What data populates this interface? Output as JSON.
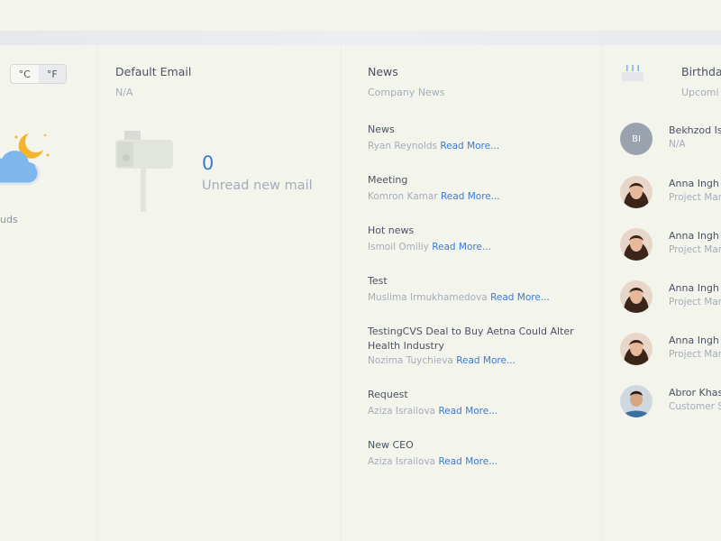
{
  "weather": {
    "unit_c": "°C",
    "unit_f": "°F",
    "description": "uds"
  },
  "email": {
    "title": "Default Email",
    "subtitle": "N/A",
    "unread_count": "0",
    "unread_label": "Unread new mail"
  },
  "news": {
    "title": "News",
    "subtitle": "Company News",
    "read_more": "Read More...",
    "items": [
      {
        "title": "News",
        "author": "Ryan Reynolds"
      },
      {
        "title": "Meeting",
        "author": "Komron Kamar"
      },
      {
        "title": "Hot news",
        "author": "Ismoil Omiliy"
      },
      {
        "title": "Test",
        "author": "Muslima Irmukhamedova"
      },
      {
        "title": "TestingCVS Deal to Buy Aetna Could Alter Health Industry",
        "author": "Nozima Tuychieva"
      },
      {
        "title": "Request",
        "author": "Aziza Israilova"
      },
      {
        "title": "New CEO",
        "author": "Aziza Israilova"
      }
    ]
  },
  "birthdays": {
    "title": "Birthda",
    "subtitle": "Upcomi",
    "people": [
      {
        "initials": "BI",
        "name": "Bekhzod Is",
        "role": "N/A",
        "avatar": "initials"
      },
      {
        "initials": "",
        "name": "Anna Ingh",
        "role": "Project Man",
        "avatar": "female"
      },
      {
        "initials": "",
        "name": "Anna Ingh",
        "role": "Project Man",
        "avatar": "female"
      },
      {
        "initials": "",
        "name": "Anna Ingh",
        "role": "Project Man",
        "avatar": "female"
      },
      {
        "initials": "",
        "name": "Anna Ingh",
        "role": "Project Man",
        "avatar": "female"
      },
      {
        "initials": "",
        "name": "Abror Khas",
        "role": "Customer S",
        "avatar": "male"
      }
    ]
  },
  "colors": {
    "accent": "#3a7bd5",
    "background": "#f3f4ec",
    "muted_text": "#a3adb9",
    "primary_text": "#4a5263"
  }
}
